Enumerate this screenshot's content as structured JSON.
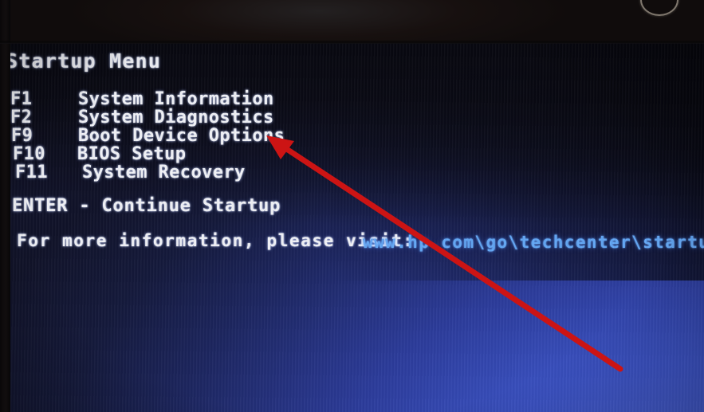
{
  "screen": {
    "title": "Startup Menu",
    "menu_items": [
      {
        "key": "F1",
        "label": "System Information"
      },
      {
        "key": "F2",
        "label": "System Diagnostics"
      },
      {
        "key": "F9",
        "label": "Boot Device Options"
      },
      {
        "key": "F10",
        "label": "BIOS Setup"
      },
      {
        "key": "F11",
        "label": "System Recovery"
      }
    ],
    "enter_line": "ENTER - Continue Startup",
    "info_line": "For more information, please visit:",
    "url": "www.hp.com\\go\\techcenter\\startup"
  },
  "annotation": {
    "arrow_color": "#cc1414",
    "points_to": "Boot Device Options"
  },
  "colors": {
    "text": "#f2f3f8",
    "url_text": "#63a7f5",
    "background_dark": "#15162c",
    "background_bright": "#3d55c6",
    "arrow_red": "#cc1414",
    "bezel": "#15100f"
  }
}
